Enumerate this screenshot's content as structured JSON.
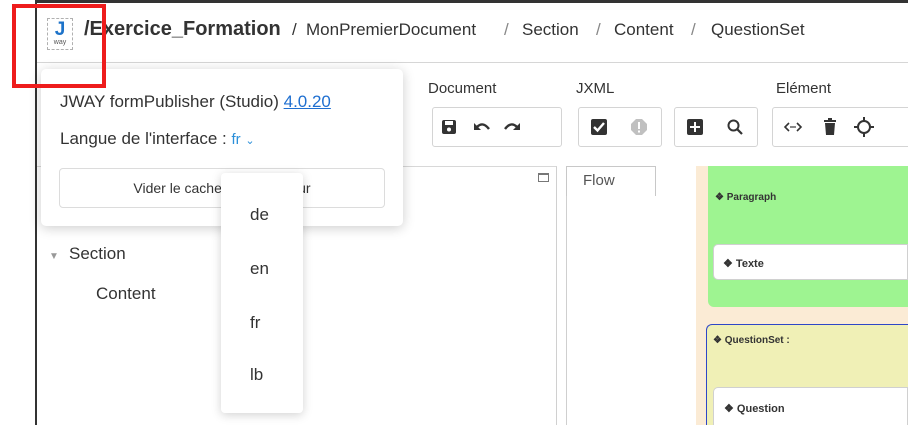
{
  "breadcrumb": {
    "root": "/Exercice_Formation",
    "separator": "/",
    "items": [
      "MonPremierDocument",
      "Section",
      "Content",
      "QuestionSet"
    ]
  },
  "logo": {
    "letter": "J",
    "sub": "way"
  },
  "toolbar": {
    "groups": [
      {
        "label": "Document"
      },
      {
        "label": "JXML"
      },
      {
        "label": "Elément"
      }
    ]
  },
  "tree": {
    "section": "Section",
    "content": "Content"
  },
  "flow": {
    "tab_label": "Flow"
  },
  "canvas": {
    "paragraph_label": "❖ Paragraph",
    "texte_label": "❖ Texte",
    "questionset_label": "❖ QuestionSet :",
    "question_label": "❖ Question"
  },
  "popover": {
    "app_name": "JWAY formPublisher (Studio)",
    "version": "4.0.20",
    "language_label": "Langue de l'interface :",
    "language_value": "fr",
    "clear_cache_label": "Vider le cache du navigateur"
  },
  "language_options": [
    "de",
    "en",
    "fr",
    "lb"
  ],
  "colors": {
    "accent": "#1f6fd0",
    "paragraph_bg": "#9ef491",
    "questionset_bg": "#f0f0b6",
    "canvas_bg": "#fbebd5",
    "highlight": "#ee1c1c"
  }
}
